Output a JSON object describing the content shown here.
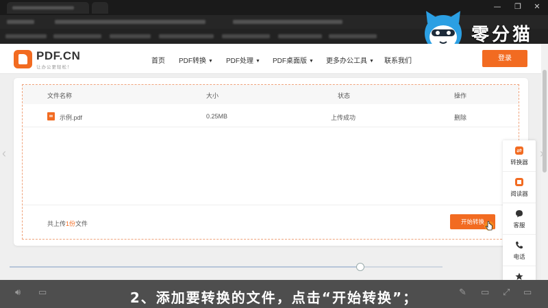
{
  "watermark": {
    "brand": "零分猫"
  },
  "window_controls": {
    "minimize": "—",
    "maximize": "❐",
    "close": "✕"
  },
  "site": {
    "logo": {
      "title": "PDF.CN",
      "subtitle": "让办公更轻松！"
    },
    "nav": [
      {
        "label": "首页"
      },
      {
        "label": "PDF转换",
        "caret": "▼"
      },
      {
        "label": "PDF处理",
        "caret": "▼"
      },
      {
        "label": "PDF桌面版",
        "caret": "▼"
      },
      {
        "label": "更多办公工具",
        "caret": "▼"
      },
      {
        "label": "联系我们"
      }
    ],
    "login": "登录"
  },
  "file_table": {
    "headers": {
      "name": "文件名称",
      "size": "大小",
      "status": "状态",
      "action": "操作"
    },
    "rows": [
      {
        "name": "示例.pdf",
        "size": "0.25MB",
        "status": "上传成功",
        "action": "删除"
      }
    ],
    "footer": {
      "prefix": "共上传",
      "count": "1份",
      "suffix": "文件"
    },
    "start_button": "开始转换"
  },
  "sidebar": [
    {
      "label": "转换器",
      "icon": "converter-icon"
    },
    {
      "label": "阅读器",
      "icon": "reader-icon"
    },
    {
      "label": "客服",
      "icon": "customer-service-icon"
    },
    {
      "label": "电话",
      "icon": "phone-icon"
    },
    {
      "label": "",
      "icon": "star-icon"
    }
  ],
  "player": {
    "progress": 0.81,
    "subtitle": "2、添加要转换的文件，点击“开始转换”；"
  },
  "colors": {
    "accent": "#f26b21"
  }
}
